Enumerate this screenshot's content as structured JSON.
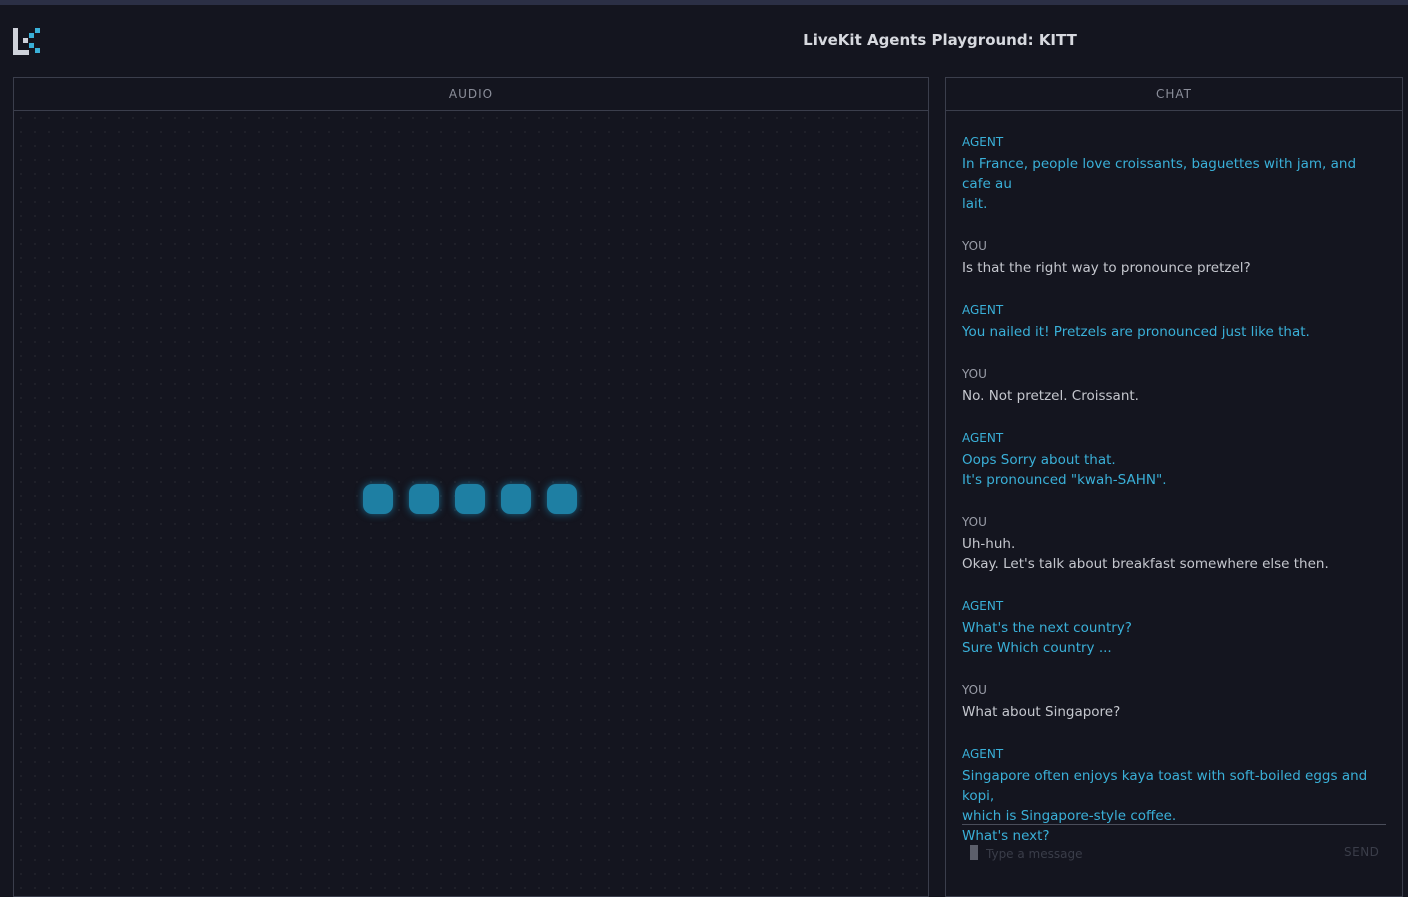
{
  "header": {
    "title": "LiveKit Agents Playground: KITT",
    "logo_icon": "livekit-logo-icon"
  },
  "colors": {
    "background": "#14151f",
    "accent": "#3ab0d8",
    "visualizer": "#1e7fa3",
    "border": "#3b3e4c"
  },
  "audio": {
    "title": "AUDIO",
    "visualizer_bars": 5
  },
  "chat": {
    "title": "CHAT",
    "messages": [
      {
        "sender": "AGENT",
        "role": "agent",
        "lines": [
          "In France, people love croissants, baguettes with jam, and cafe au",
          "lait."
        ]
      },
      {
        "sender": "YOU",
        "role": "you",
        "lines": [
          "Is that the right way to pronounce pretzel?"
        ]
      },
      {
        "sender": "AGENT",
        "role": "agent",
        "lines": [
          "You nailed it! Pretzels are pronounced just like that."
        ]
      },
      {
        "sender": "YOU",
        "role": "you",
        "lines": [
          "No. Not pretzel. Croissant."
        ]
      },
      {
        "sender": "AGENT",
        "role": "agent",
        "lines": [
          "Oops Sorry about that.",
          "It's pronounced \"kwah-SAHN\"."
        ]
      },
      {
        "sender": "YOU",
        "role": "you",
        "lines": [
          "Uh-huh.",
          "Okay. Let's talk about breakfast somewhere else then."
        ]
      },
      {
        "sender": "AGENT",
        "role": "agent",
        "lines": [
          "What's the next country?",
          "Sure Which country ..."
        ]
      },
      {
        "sender": "YOU",
        "role": "you",
        "lines": [
          "What about Singapore?"
        ]
      },
      {
        "sender": "AGENT",
        "role": "agent",
        "lines": [
          "Singapore often enjoys kaya toast with soft-boiled eggs and kopi,",
          "which is Singapore-style coffee.",
          "What's next?"
        ]
      }
    ],
    "input_placeholder": "Type a message",
    "input_value": "",
    "send_label": "SEND"
  }
}
